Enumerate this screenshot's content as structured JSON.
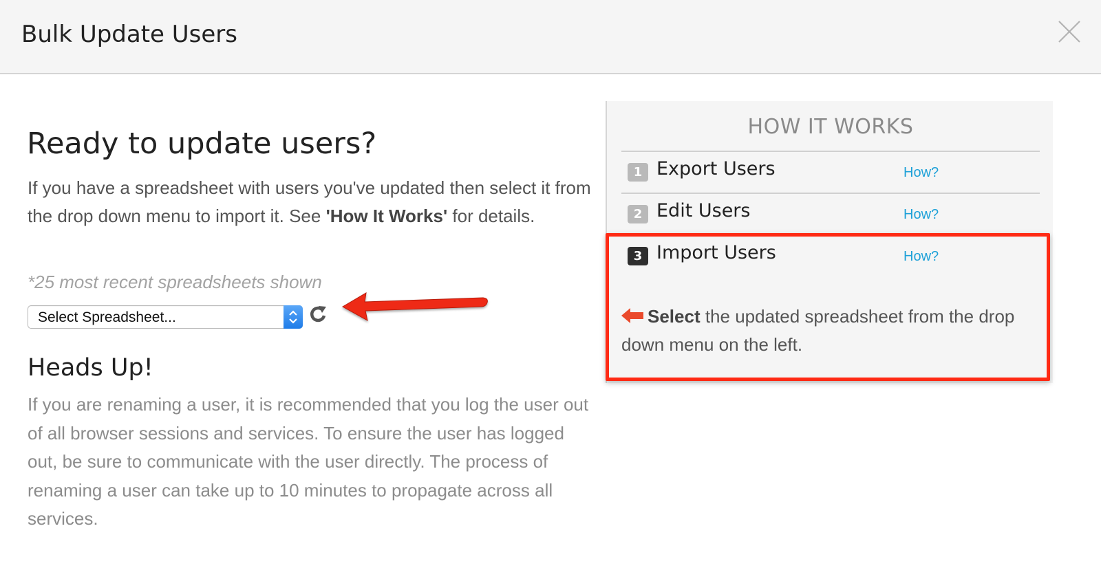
{
  "dialog": {
    "title": "Bulk Update Users"
  },
  "main": {
    "heading": "Ready to update users?",
    "intro_before": "If you have a spreadsheet with users you've updated then select it from the drop down menu to import it. See ",
    "intro_bold": "'How It Works'",
    "intro_after": " for details.",
    "recent_note": "*25 most recent spreadsheets shown",
    "select_value": "Select Spreadsheet...",
    "heads_up_title": "Heads Up!",
    "heads_up_text": "If you are renaming a user, it is recommended that you log the user out of all browser sessions and services. To ensure the user has logged out, be sure to communicate with the user directly. The process of renaming a user can take up to 10 minutes to propagate across all services."
  },
  "how_it_works": {
    "title": "HOW IT WORKS",
    "steps": [
      {
        "number": "1",
        "label": "Export Users",
        "link": "How?"
      },
      {
        "number": "2",
        "label": "Edit Users",
        "link": "How?"
      },
      {
        "number": "3",
        "label": "Import Users",
        "link": "How?"
      }
    ],
    "instruction_bold": "Select",
    "instruction_text": " the updated spreadsheet from the drop down menu on the left."
  },
  "colors": {
    "annotation_red": "#ff2a14",
    "link_blue": "#1ea1d8",
    "select_accent": "#1f7ce8"
  },
  "icons": {
    "close": "close-icon",
    "refresh": "refresh-icon",
    "annotation_arrow": "red-arrow-icon",
    "pointer": "left-arrow-icon"
  }
}
